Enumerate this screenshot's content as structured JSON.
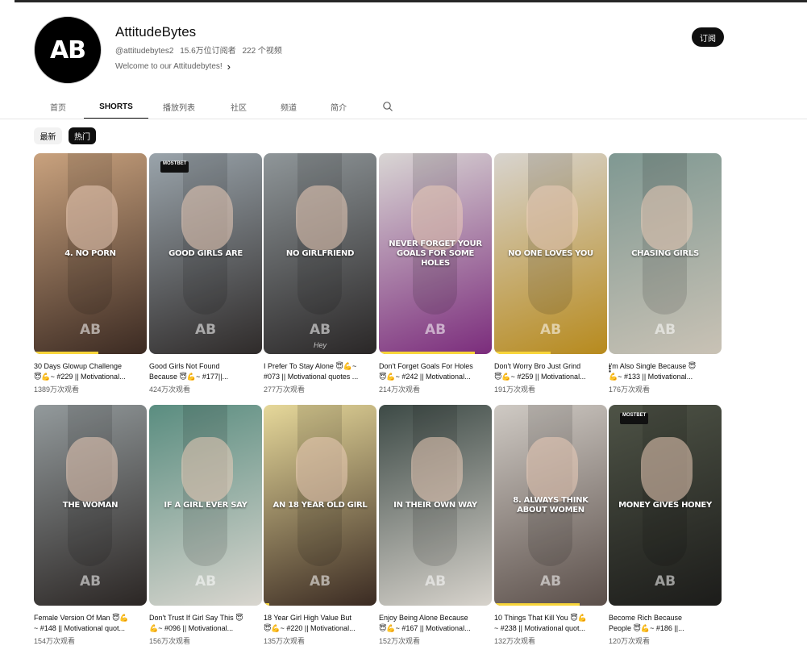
{
  "channel": {
    "avatar_text": "AB",
    "name": "AttitudeBytes",
    "handle": "@attitudebytes2",
    "subscribers": "15.6万位订阅者",
    "videos": "222 个视频",
    "description": "Welcome to our Attitudebytes!",
    "subscribe_label": "订阅"
  },
  "tabs": [
    {
      "label": "首页"
    },
    {
      "label": "SHORTS"
    },
    {
      "label": "播放列表"
    },
    {
      "label": "社区"
    },
    {
      "label": "频道"
    },
    {
      "label": "简介"
    }
  ],
  "chips": {
    "latest": "最新",
    "popular": "热门"
  },
  "watermark": "AB",
  "shorts": [
    {
      "overlay": "4. NO PORN",
      "title": "30 Days Glowup Challenge\n😇💪~ #229 || Motivational...",
      "views": "1389万次观看",
      "bg": [
        "#c9a27e",
        "#3b2a22"
      ]
    },
    {
      "overlay": "GOOD GIRLS ARE",
      "title": "Good Girls Not Found\nBecause 😇💪~ #177||...",
      "views": "424万次观看",
      "bg": [
        "#9aa4ab",
        "#2f2b2a"
      ],
      "badge": "MOSTBET"
    },
    {
      "overlay": "NO GIRLFRIEND",
      "title": "I Prefer To Stay Alone 😇💪~\n#073 || Motivational quotes ...",
      "views": "277万次观看",
      "bg": [
        "#8f9699",
        "#2a2727"
      ],
      "hey": "Hey"
    },
    {
      "overlay": "NEVER FORGET YOUR GOALS FOR SOME HOLES",
      "title": "Don't Forget Goals For Holes\n😇💪~ #242 || Motivational...",
      "views": "214万次观看",
      "bg": [
        "#d9d6d4",
        "#7b2c7c"
      ]
    },
    {
      "overlay": "NO ONE LOVES YOU",
      "title": "Don't Worry Bro Just Grind\n😇💪~ #259 || Motivational...",
      "views": "191万次观看",
      "bg": [
        "#d8d4cf",
        "#b78a1d"
      ]
    },
    {
      "overlay": "CHASING GIRLS",
      "title": "I'm Also Single Because 😇\n💪~ #133 || Motivational...",
      "views": "176万次观看",
      "bg": [
        "#7f9892",
        "#c9c2b5"
      ]
    },
    {
      "overlay": "THE WOMAN",
      "title": "Female Version Of Man 😇💪\n~ #148 || Motivational quot...",
      "views": "154万次观看",
      "bg": [
        "#939a9c",
        "#2b2624"
      ]
    },
    {
      "overlay": "IF A GIRL EVER SAY",
      "title": "Don't Trust If Girl Say This 😇\n💪~ #096 || Motivational...",
      "views": "156万次观看",
      "bg": [
        "#5a8d80",
        "#d9d6cf"
      ]
    },
    {
      "overlay": "AN 18 YEAR OLD GIRL",
      "title": "18 Year Girl High Value But\n😇💪~ #220 || Motivational...",
      "views": "135万次观看",
      "bg": [
        "#e6d89a",
        "#3a2a22"
      ]
    },
    {
      "overlay": "IN THEIR OWN WAY",
      "title": "Enjoy Being Alone Because\n😇💪~ #167 || Motivational...",
      "views": "152万次观看",
      "bg": [
        "#3d4a46",
        "#d7d3cc"
      ]
    },
    {
      "overlay": "8. ALWAYS THINK ABOUT WOMEN",
      "title": "10 Things That Kill You 😇💪\n~ #238 || Motivational quot...",
      "views": "132万次观看",
      "bg": [
        "#cfcac4",
        "#5b4f4a"
      ]
    },
    {
      "overlay": "MONEY GIVES HONEY",
      "title": "Become Rich Because\nPeople 😇💪~ #186 ||...",
      "views": "120万次观看",
      "bg": [
        "#4e5346",
        "#1c1c1a"
      ],
      "badge": "MOSTBET"
    }
  ]
}
